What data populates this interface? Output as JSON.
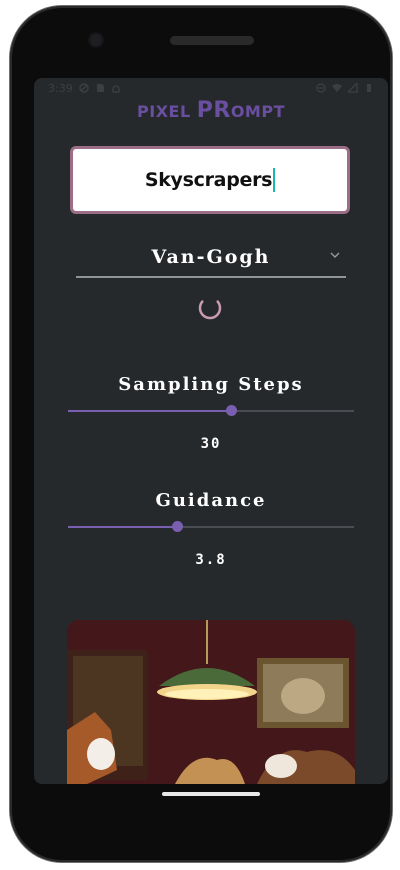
{
  "status_bar": {
    "time": "3:39"
  },
  "app": {
    "title_part1": "PIXEL ",
    "title_part2": "PR",
    "title_part3": "OMPT"
  },
  "prompt": {
    "value": "Skyscrapers"
  },
  "style_select": {
    "selected": "Van-Gogh"
  },
  "sampling_steps": {
    "label": "Sampling Steps",
    "value": "30",
    "level_fraction": 0.57
  },
  "guidance": {
    "label": "Guidance",
    "value": "3.8",
    "level_fraction": 0.38
  },
  "colors": {
    "accent": "#7a5fb0",
    "prompt_border": "#9b6d86",
    "background": "#26292c"
  },
  "image": {
    "description_icon": "generated-image"
  }
}
